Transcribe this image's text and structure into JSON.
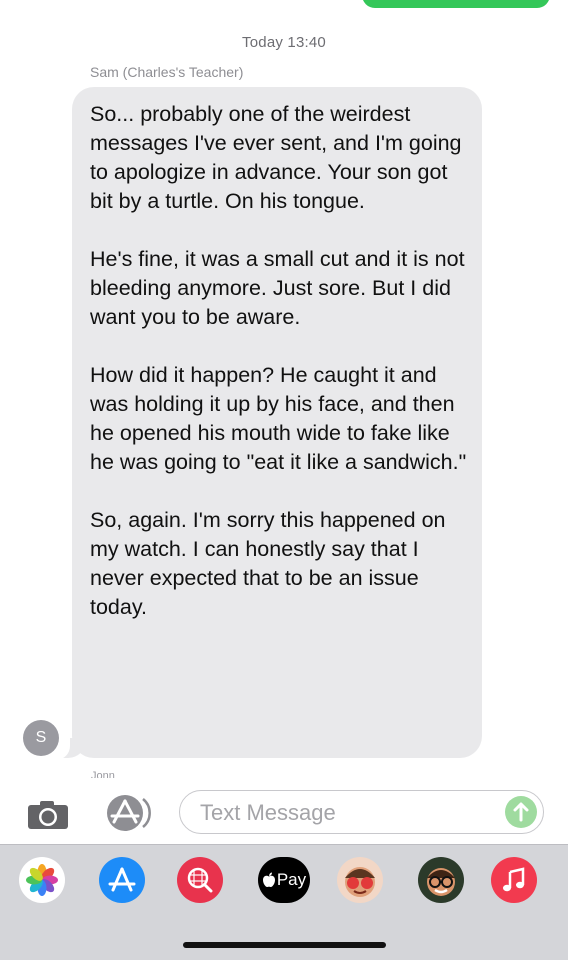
{
  "conversation": {
    "timestamp": "Today 13:40",
    "sender_name": "Sam (Charles's Teacher)",
    "avatar_initial": "S",
    "message_paragraphs": [
      "So... probably one of the weirdest messages I've ever sent, and I'm going to apologize in advance. Your son got bit by a turtle. On his tongue.",
      "He's fine, it was a small cut and it is not bleeding anymore. Just sore. But I did want you to be aware.",
      "How did it happen? He caught it and was holding it up by his face, and then he opened his mouth wide to fake like he was going to \"eat it like a sandwich.\"",
      "So, again. I'm sorry this happened on my watch. I can honestly say that I never expected that to be an issue today."
    ],
    "next_sender_partial": "Jonn"
  },
  "compose": {
    "placeholder": "Text Message",
    "value": ""
  },
  "app_tray": {
    "apple_pay_label": "Pay",
    "icons": [
      "photos-icon",
      "app-store-icon",
      "web-images-icon",
      "apple-pay-icon",
      "animoji-icon",
      "memoji-icon",
      "music-icon"
    ]
  },
  "colors": {
    "sent_bubble": "#34c759",
    "received_bubble": "#e9e9eb",
    "send_button": "#9fdb9f",
    "tray_background": "#d4d5d9"
  }
}
